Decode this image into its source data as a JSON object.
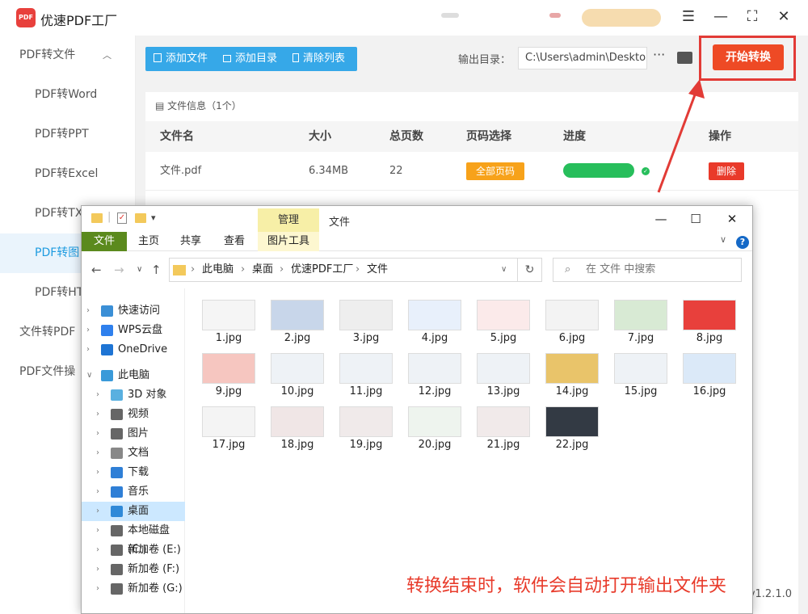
{
  "app": {
    "title": "优速PDF工厂",
    "logo_text": "PDF",
    "version": "v1.2.1.0"
  },
  "window": {
    "menu_icon": "hamburger-icon",
    "minimize": "—",
    "maximize": "⛶",
    "close": "✕"
  },
  "sidebar": {
    "items": [
      {
        "label": "PDF转文件",
        "type": "group",
        "expanded": true
      },
      {
        "label": "PDF转Word",
        "type": "sub"
      },
      {
        "label": "PDF转PPT",
        "type": "sub"
      },
      {
        "label": "PDF转Excel",
        "type": "sub"
      },
      {
        "label": "PDF转TX",
        "type": "sub"
      },
      {
        "label": "PDF转图",
        "type": "sub",
        "active": true
      },
      {
        "label": "PDF转HT",
        "type": "sub"
      },
      {
        "label": "文件转PDF",
        "type": "group"
      },
      {
        "label": "PDF文件操",
        "type": "group"
      }
    ]
  },
  "toolbar": {
    "add_file": "添加文件",
    "add_dir": "添加目录",
    "clear_list": "清除列表",
    "output_label": "输出目录：",
    "output_path": "C:\\Users\\admin\\Deskto",
    "more": "···",
    "start": "开始转换"
  },
  "file_panel": {
    "count_label": "文件信息（1个）",
    "columns": [
      "文件名",
      "大小",
      "总页数",
      "页码选择",
      "进度",
      "操作"
    ],
    "rows": [
      {
        "name": "文件.pdf",
        "size": "6.34MB",
        "pages": "22",
        "page_select": "全部页码",
        "progress": 1.0,
        "action": "删除"
      }
    ]
  },
  "explorer": {
    "manage_tab": "管理",
    "title": "文件",
    "ribbon_tabs": [
      "文件",
      "主页",
      "共享",
      "查看",
      "图片工具"
    ],
    "help": "?",
    "breadcrumb": [
      "此电脑",
      "桌面",
      "优速PDF工厂",
      "文件"
    ],
    "search_placeholder": "在 文件 中搜索",
    "nav": [
      {
        "label": "快速访问",
        "icon": "star-icon",
        "color": "#3b8fd6",
        "level": 0
      },
      {
        "label": "WPS云盘",
        "icon": "cloud-icon",
        "color": "#2f80ed",
        "level": 0
      },
      {
        "label": "OneDrive",
        "icon": "cloud-icon",
        "color": "#1e74d4",
        "level": 0
      },
      {
        "label": "此电脑",
        "icon": "computer-icon",
        "color": "#3a9ad9",
        "level": 0,
        "expanded": true
      },
      {
        "label": "3D 对象",
        "icon": "cube-icon",
        "color": "#59b0e0",
        "level": 1
      },
      {
        "label": "视频",
        "icon": "video-icon",
        "color": "#666666",
        "level": 1
      },
      {
        "label": "图片",
        "icon": "picture-icon",
        "color": "#666666",
        "level": 1
      },
      {
        "label": "文档",
        "icon": "document-icon",
        "color": "#888888",
        "level": 1
      },
      {
        "label": "下载",
        "icon": "download-icon",
        "color": "#2f7fd6",
        "level": 1
      },
      {
        "label": "音乐",
        "icon": "music-icon",
        "color": "#2f7fd6",
        "level": 1
      },
      {
        "label": "桌面",
        "icon": "desktop-icon",
        "color": "#2f89d8",
        "level": 1,
        "selected": true
      },
      {
        "label": "本地磁盘 (C:)",
        "icon": "drive-icon",
        "color": "#666666",
        "level": 1
      },
      {
        "label": "新加卷 (E:)",
        "icon": "drive-icon",
        "color": "#666666",
        "level": 1
      },
      {
        "label": "新加卷 (F:)",
        "icon": "drive-icon",
        "color": "#666666",
        "level": 1
      },
      {
        "label": "新加卷 (G:)",
        "icon": "drive-icon",
        "color": "#666666",
        "level": 1
      }
    ],
    "files": [
      "1.jpg",
      "2.jpg",
      "3.jpg",
      "4.jpg",
      "5.jpg",
      "6.jpg",
      "7.jpg",
      "8.jpg",
      "9.jpg",
      "10.jpg",
      "11.jpg",
      "12.jpg",
      "13.jpg",
      "14.jpg",
      "15.jpg",
      "16.jpg",
      "17.jpg",
      "18.jpg",
      "19.jpg",
      "20.jpg",
      "21.jpg",
      "22.jpg"
    ]
  },
  "annotation": "转换结束时，软件会自动打开输出文件夹",
  "colors": {
    "accent": "#36a8e8",
    "start": "#ee4a25",
    "highlight": "#e23b36",
    "progress": "#27be5b",
    "badge": "#f7a21a"
  }
}
